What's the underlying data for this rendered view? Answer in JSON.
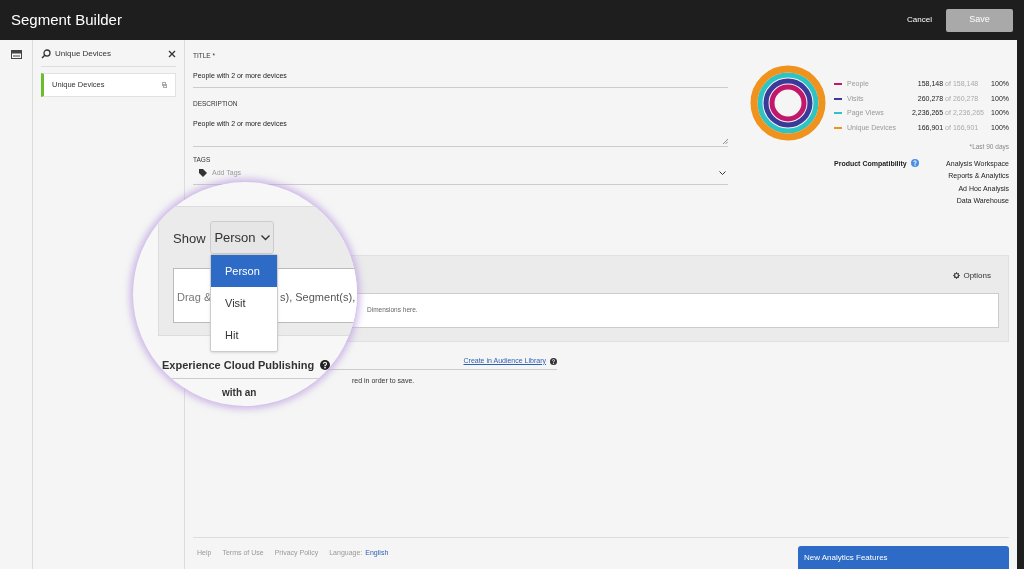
{
  "window": {
    "title": "Segment Builder",
    "buttons": [
      {
        "label": "Cancel",
        "disabled": false
      },
      {
        "label": "Save",
        "disabled": true
      }
    ]
  },
  "sidebar": {
    "search": "Unique Devices",
    "items": [
      {
        "label": "Unique Devices",
        "selected": true
      }
    ]
  },
  "form": {
    "title_label": "TITLE *",
    "title_value": "People with 2 or more devices",
    "description_label": "DESCRIPTION",
    "description_value": "People with 2 or more devices",
    "tags_label": "TAGS",
    "tags_placeholder": "Add Tags"
  },
  "summary": {
    "metrics": [
      {
        "name": "People",
        "color": "#c2186b",
        "value": "158,148",
        "total": "of 158,148",
        "percent": "100%"
      },
      {
        "name": "Visits",
        "color": "#3a3a9a",
        "value": "260,278",
        "total": "of 260,278",
        "percent": "100%"
      },
      {
        "name": "Page Views",
        "color": "#2ec4c4",
        "value": "2,236,265",
        "total": "of 2,236,265",
        "percent": "100%"
      },
      {
        "name": "Unique Devices",
        "color": "#f0921e",
        "value": "166,901",
        "total": "of 166,901",
        "percent": "100%"
      }
    ],
    "note": "*Last 90 days",
    "compatibility_label": "Product Compatibility",
    "products": [
      "Analysis Workspace",
      "Reports & Analytics",
      "Ad Hoc Analysis",
      "Data Warehouse"
    ]
  },
  "definition": {
    "options": "Options",
    "drop_hint": "Dimensions here.",
    "audience_link": "Create in Audience Library",
    "save_note": "red in order to save."
  },
  "magnifier": {
    "show_label": "Show",
    "show_value": "Person",
    "options": [
      {
        "label": "Person",
        "selected": true
      },
      {
        "label": "Visit",
        "selected": false
      },
      {
        "label": "Hit",
        "selected": false
      }
    ],
    "drop_parts": [
      "Drag &",
      "s), Segment(s),"
    ],
    "publishing": "Experience Cloud Publishing",
    "cut_text": "with an"
  },
  "footer": {
    "links": [
      "Help",
      "Terms of Use",
      "Privacy Policy"
    ],
    "language_label": "Language:",
    "language": "English",
    "features": "New Analytics Features"
  }
}
